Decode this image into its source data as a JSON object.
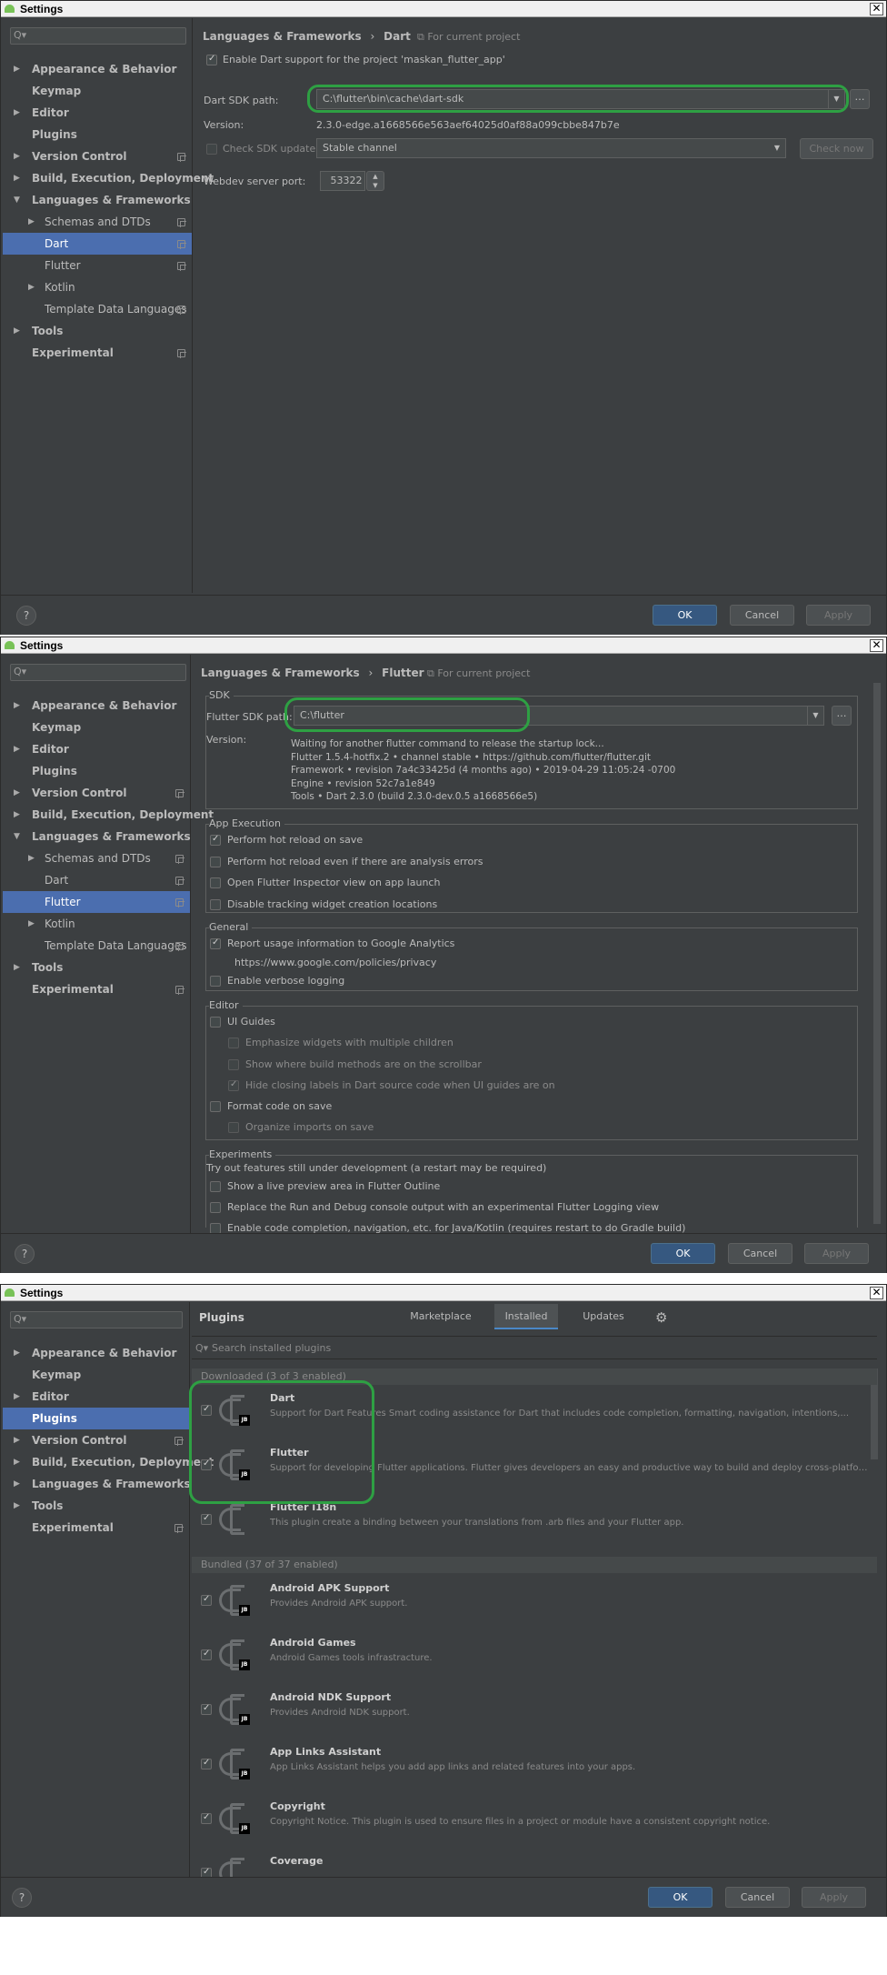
{
  "window_title": "Settings",
  "close_glyph": "✕",
  "help_glyph": "?",
  "search_glyph": "Q▾",
  "panel1": {
    "sidebar": [
      {
        "label": "Appearance & Behavior",
        "arrow": "▶",
        "bold": true,
        "indent": 0,
        "selected": false,
        "copy": false
      },
      {
        "label": "Keymap",
        "arrow": "",
        "bold": true,
        "indent": 0,
        "selected": false,
        "copy": false
      },
      {
        "label": "Editor",
        "arrow": "▶",
        "bold": true,
        "indent": 0,
        "selected": false,
        "copy": false
      },
      {
        "label": "Plugins",
        "arrow": "",
        "bold": true,
        "indent": 0,
        "selected": false,
        "copy": false
      },
      {
        "label": "Version Control",
        "arrow": "▶",
        "bold": true,
        "indent": 0,
        "selected": false,
        "copy": true
      },
      {
        "label": "Build, Execution, Deployment",
        "arrow": "▶",
        "bold": true,
        "indent": 0,
        "selected": false,
        "copy": false
      },
      {
        "label": "Languages & Frameworks",
        "arrow": "▼",
        "bold": true,
        "indent": 0,
        "selected": false,
        "copy": false
      },
      {
        "label": "Schemas and DTDs",
        "arrow": "▶",
        "bold": false,
        "indent": 1,
        "selected": false,
        "copy": true
      },
      {
        "label": "Dart",
        "arrow": "",
        "bold": false,
        "indent": 1,
        "selected": true,
        "copy": true
      },
      {
        "label": "Flutter",
        "arrow": "",
        "bold": false,
        "indent": 1,
        "selected": false,
        "copy": true
      },
      {
        "label": "Kotlin",
        "arrow": "▶",
        "bold": false,
        "indent": 1,
        "selected": false,
        "copy": false
      },
      {
        "label": "Template Data Languages",
        "arrow": "",
        "bold": false,
        "indent": 1,
        "selected": false,
        "copy": true
      },
      {
        "label": "Tools",
        "arrow": "▶",
        "bold": true,
        "indent": 0,
        "selected": false,
        "copy": false
      },
      {
        "label": "Experimental",
        "arrow": "",
        "bold": true,
        "indent": 0,
        "selected": false,
        "copy": true
      }
    ],
    "breadcrumb_parent": "Languages & Frameworks",
    "breadcrumb_sep": "›",
    "breadcrumb_current": "Dart",
    "for_current_project": "For current project",
    "enable_dart": "Enable Dart support for the project 'maskan_flutter_app'",
    "sdk_path_label": "Dart SDK path:",
    "sdk_path_value": "C:\\flutter\\bin\\cache\\dart-sdk",
    "version_label": "Version:",
    "version_value": "2.3.0-edge.a1668566e563aef64025d0af88a099cbbe847b7e",
    "check_sdk_update": "Check SDK update:",
    "channel_value": "Stable channel",
    "check_now": "Check now",
    "webdev_label": "Webdev server port:",
    "webdev_value": "53322",
    "ok": "OK",
    "cancel": "Cancel",
    "apply": "Apply"
  },
  "panel2": {
    "sidebar": [
      {
        "label": "Appearance & Behavior",
        "arrow": "▶",
        "bold": true,
        "indent": 0,
        "selected": false,
        "copy": false
      },
      {
        "label": "Keymap",
        "arrow": "",
        "bold": true,
        "indent": 0,
        "selected": false,
        "copy": false
      },
      {
        "label": "Editor",
        "arrow": "▶",
        "bold": true,
        "indent": 0,
        "selected": false,
        "copy": false
      },
      {
        "label": "Plugins",
        "arrow": "",
        "bold": true,
        "indent": 0,
        "selected": false,
        "copy": false
      },
      {
        "label": "Version Control",
        "arrow": "▶",
        "bold": true,
        "indent": 0,
        "selected": false,
        "copy": true
      },
      {
        "label": "Build, Execution, Deployment",
        "arrow": "▶",
        "bold": true,
        "indent": 0,
        "selected": false,
        "copy": false
      },
      {
        "label": "Languages & Frameworks",
        "arrow": "▼",
        "bold": true,
        "indent": 0,
        "selected": false,
        "copy": false
      },
      {
        "label": "Schemas and DTDs",
        "arrow": "▶",
        "bold": false,
        "indent": 1,
        "selected": false,
        "copy": true
      },
      {
        "label": "Dart",
        "arrow": "",
        "bold": false,
        "indent": 1,
        "selected": false,
        "copy": true
      },
      {
        "label": "Flutter",
        "arrow": "",
        "bold": false,
        "indent": 1,
        "selected": true,
        "copy": true
      },
      {
        "label": "Kotlin",
        "arrow": "▶",
        "bold": false,
        "indent": 1,
        "selected": false,
        "copy": false
      },
      {
        "label": "Template Data Languages",
        "arrow": "",
        "bold": false,
        "indent": 1,
        "selected": false,
        "copy": true
      },
      {
        "label": "Tools",
        "arrow": "▶",
        "bold": true,
        "indent": 0,
        "selected": false,
        "copy": false
      },
      {
        "label": "Experimental",
        "arrow": "",
        "bold": true,
        "indent": 0,
        "selected": false,
        "copy": true
      }
    ],
    "breadcrumb_parent": "Languages & Frameworks",
    "breadcrumb_sep": "›",
    "breadcrumb_current": "Flutter",
    "for_current_project": "For current project",
    "sdk_group": "SDK",
    "sdk_path_label": "Flutter SDK path:",
    "sdk_path_value": "C:\\flutter",
    "version_label": "Version:",
    "version_lines": [
      "Waiting for another flutter command to release the startup lock...",
      "Flutter 1.5.4-hotfix.2 • channel stable • https://github.com/flutter/flutter.git",
      "Framework • revision 7a4c33425d (4 months ago) • 2019-04-29 11:05:24 -0700",
      "Engine • revision 52c7a1e849",
      "Tools • Dart 2.3.0 (build 2.3.0-dev.0.5 a1668566e5)"
    ],
    "app_exec_group": "App Execution",
    "app_exec": [
      {
        "label": "Perform hot reload on save",
        "checked": true
      },
      {
        "label": "Perform hot reload even if there are analysis errors",
        "checked": false
      },
      {
        "label": "Open Flutter Inspector view on app launch",
        "checked": false
      },
      {
        "label": "Disable tracking widget creation locations",
        "checked": false
      }
    ],
    "general_group": "General",
    "report_usage": "Report usage information to Google Analytics",
    "privacy_url": "https://www.google.com/policies/privacy",
    "verbose_logging": "Enable verbose logging",
    "editor_group": "Editor",
    "ui_guides": "UI Guides",
    "ui_sub": [
      {
        "label": "Emphasize widgets with multiple children",
        "checked": false
      },
      {
        "label": "Show where build methods are on the scrollbar",
        "checked": false
      },
      {
        "label": "Hide closing labels in Dart source code when UI guides are on",
        "checked": true
      }
    ],
    "format_on_save": "Format code on save",
    "organize_imports": "Organize imports on save",
    "experiments_group": "Experiments",
    "experiments_note": "Try out features still under development (a restart may be required)",
    "experiments": [
      {
        "label": "Show a live preview area in Flutter Outline"
      },
      {
        "label": "Replace the Run and Debug console output with an experimental Flutter Logging view"
      },
      {
        "label": "Enable code completion, navigation, etc. for Java/Kotlin (requires restart to do Gradle build)"
      }
    ],
    "ok": "OK",
    "cancel": "Cancel",
    "apply": "Apply"
  },
  "panel3": {
    "sidebar": [
      {
        "label": "Appearance & Behavior",
        "arrow": "▶",
        "bold": true,
        "indent": 0,
        "selected": false,
        "copy": false
      },
      {
        "label": "Keymap",
        "arrow": "",
        "bold": true,
        "indent": 0,
        "selected": false,
        "copy": false
      },
      {
        "label": "Editor",
        "arrow": "▶",
        "bold": true,
        "indent": 0,
        "selected": false,
        "copy": false
      },
      {
        "label": "Plugins",
        "arrow": "",
        "bold": true,
        "indent": 0,
        "selected": true,
        "copy": false
      },
      {
        "label": "Version Control",
        "arrow": "▶",
        "bold": true,
        "indent": 0,
        "selected": false,
        "copy": true
      },
      {
        "label": "Build, Execution, Deployment",
        "arrow": "▶",
        "bold": true,
        "indent": 0,
        "selected": false,
        "copy": false
      },
      {
        "label": "Languages & Frameworks",
        "arrow": "▶",
        "bold": true,
        "indent": 0,
        "selected": false,
        "copy": false
      },
      {
        "label": "Tools",
        "arrow": "▶",
        "bold": true,
        "indent": 0,
        "selected": false,
        "copy": false
      },
      {
        "label": "Experimental",
        "arrow": "",
        "bold": true,
        "indent": 0,
        "selected": false,
        "copy": true
      }
    ],
    "title": "Plugins",
    "tabs": [
      "Marketplace",
      "Installed",
      "Updates"
    ],
    "selected_tab": 1,
    "gear_glyph": "⚙",
    "search_placeholder": "Search installed plugins",
    "downloaded_section": "Downloaded (3 of 3 enabled)",
    "bundled_section": "Bundled (37 of 37 enabled)",
    "downloaded": [
      {
        "name": "Dart",
        "desc": "Support for Dart Features Smart coding assistance for Dart that includes code completion, formatting, navigation, intentions,...",
        "jb": true
      },
      {
        "name": "Flutter",
        "desc": "Support for developing Flutter applications. Flutter gives developers an easy and productive way to build and deploy cross-platform,...",
        "jb": true
      },
      {
        "name": "Flutter i18n",
        "desc": "This plugin create a binding between your translations from .arb files and your Flutter app.",
        "jb": false
      }
    ],
    "bundled": [
      {
        "name": "Android APK Support",
        "desc": "Provides Android APK support.",
        "jb": true
      },
      {
        "name": "Android Games",
        "desc": "Android Games tools infrastracture.",
        "jb": true
      },
      {
        "name": "Android NDK Support",
        "desc": "Provides Android NDK support.",
        "jb": true
      },
      {
        "name": "App Links Assistant",
        "desc": "App Links Assistant helps you add app links and related features into your apps.",
        "jb": true
      },
      {
        "name": "Copyright",
        "desc": "Copyright Notice. This plugin is used to ensure files in a project or module have a consistent copyright notice.",
        "jb": true
      },
      {
        "name": "Coverage",
        "desc": "",
        "jb": true
      }
    ],
    "jb_text": "JB",
    "ok": "OK",
    "cancel": "Cancel",
    "apply": "Apply"
  },
  "colors": {
    "highlight": "#2ea043",
    "selected": "#4b6eaf",
    "panel_bg": "#3c3f41"
  }
}
